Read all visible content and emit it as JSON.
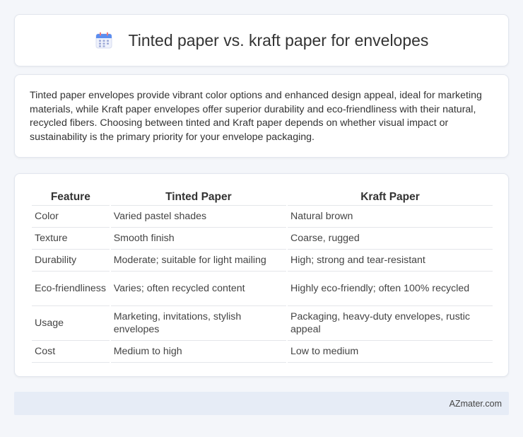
{
  "header": {
    "title": "Tinted paper vs. kraft paper for envelopes",
    "icon": "calendar-icon"
  },
  "summary": {
    "text": "Tinted paper envelopes provide vibrant color options and enhanced design appeal, ideal for marketing materials, while Kraft paper envelopes offer superior durability and eco-friendliness with their natural, recycled fibers. Choosing between tinted and Kraft paper depends on whether visual impact or sustainability is the primary priority for your envelope packaging."
  },
  "table": {
    "headers": [
      "Feature",
      "Tinted Paper",
      "Kraft Paper"
    ],
    "rows": [
      [
        "Color",
        "Varied pastel shades",
        "Natural brown"
      ],
      [
        "Texture",
        "Smooth finish",
        "Coarse, rugged"
      ],
      [
        "Durability",
        "Moderate; suitable for light mailing",
        "High; strong and tear-resistant"
      ],
      [
        "Eco-friendliness",
        "Varies; often recycled content",
        "Highly eco-friendly; often 100% recycled"
      ],
      [
        "Usage",
        "Marketing, invitations, stylish envelopes",
        "Packaging, heavy-duty envelopes, rustic appeal"
      ],
      [
        "Cost",
        "Medium to high",
        "Low to medium"
      ]
    ]
  },
  "footer": {
    "brand": "AZmater.com"
  },
  "colors": {
    "background": "#f4f6fa",
    "card": "#ffffff",
    "footer_bar": "#e6ecf6",
    "icon_accent": "#5b8def"
  }
}
